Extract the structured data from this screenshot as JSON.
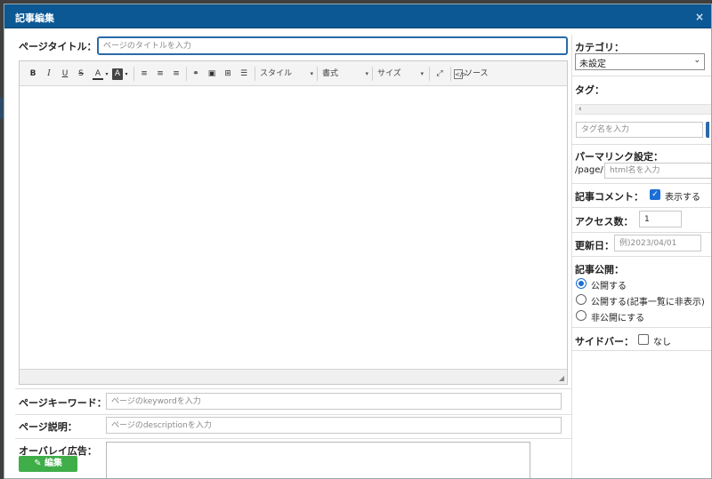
{
  "modal": {
    "title": "記事編集",
    "close": "×"
  },
  "main": {
    "title_label": "ページタイトル：",
    "title_placeholder": "ページのタイトルを入力",
    "toolbar": {
      "bold": "B",
      "italic": "I",
      "underline": "U",
      "strike": "S",
      "text_color": "A",
      "bg_color": "A",
      "style_label": "スタイル",
      "format_label": "書式",
      "size_label": "サイズ",
      "source_label": "ソース"
    },
    "keyword_label": "ページキーワード：",
    "keyword_placeholder": "ページのkeywordを入力",
    "description_label": "ページ説明：",
    "description_placeholder": "ページのdescriptionを入力",
    "overlay_label": "オーバレイ広告：",
    "edit_button": "編集"
  },
  "sidebar": {
    "category_label": "カテゴリ：",
    "category_value": "未設定",
    "tag_label": "タグ：",
    "tag_placeholder": "タグ名を入力",
    "permalink_label": "パーマリンク設定：",
    "permalink_prefix": "/page/",
    "permalink_placeholder": "html名を入力",
    "comment_label": "記事コメント：",
    "comment_option": "表示する",
    "access_label": "アクセス数：",
    "access_value": "1",
    "updated_label": "更新日：",
    "updated_placeholder": "例)2023/04/01",
    "publish_label": "記事公開：",
    "publish_options": [
      "公開する",
      "公開する(記事一覧に非表示)",
      "非公開にする"
    ],
    "sidebar_label": "サイドバー：",
    "sidebar_option": "なし"
  },
  "colors": {
    "header": "#0b5894",
    "accent": "#1c6fd6",
    "edit_button": "#3fae49"
  }
}
